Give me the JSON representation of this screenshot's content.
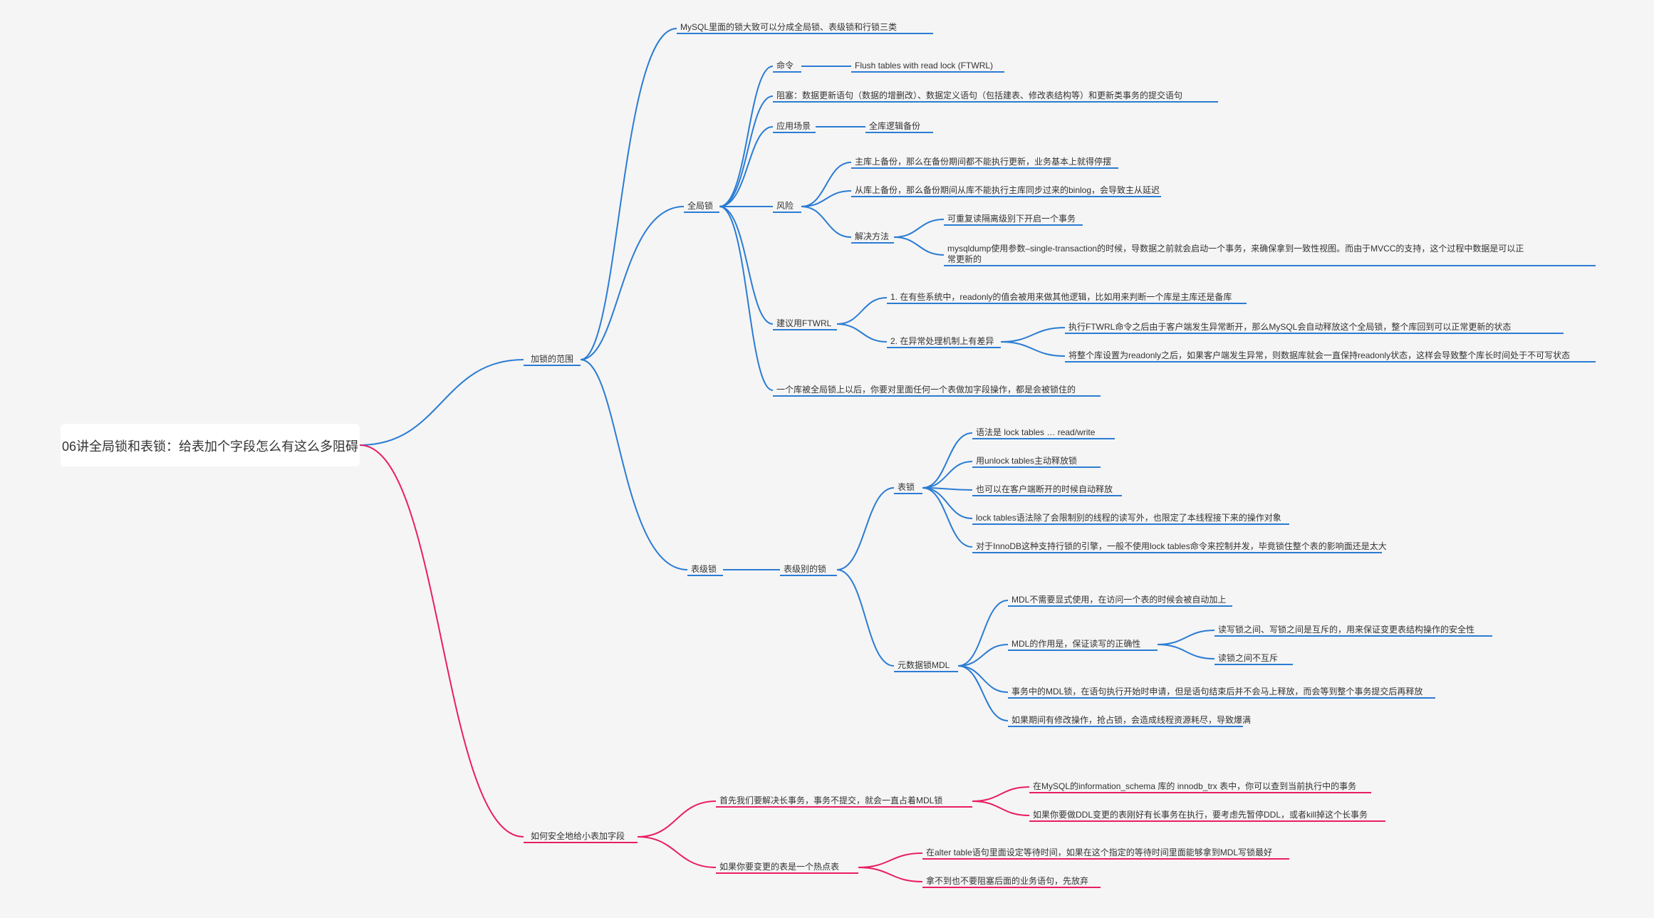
{
  "root": "06讲全局锁和表锁：给表加个字段怎么有这么多阻碍",
  "b1": {
    "title": "加锁的范围",
    "intro": "MySQL里面的锁大致可以分成全局锁、表级锁和行锁三类",
    "global": {
      "title": "全局锁",
      "cmd": {
        "k": "命令",
        "v": "Flush tables with read lock (FTWRL)"
      },
      "block": "阻塞：数据更新语句（数据的增删改）、数据定义语句（包括建表、修改表结构等）和更新类事务的提交语句",
      "usage": {
        "k": "应用场景",
        "v": "全库逻辑备份"
      },
      "risk": {
        "title": "风险",
        "r1": "主库上备份，那么在备份期间都不能执行更新，业务基本上就得停摆",
        "r2": "从库上备份，那么备份期间从库不能执行主库同步过来的binlog，会导致主从延迟",
        "solve": {
          "title": "解决方法",
          "s1": "可重复读隔离级别下开启一个事务",
          "s2": "mysqldump使用参数–single-transaction的时候，导数据之前就会启动一个事务，来确保拿到一致性视图。而由于MVCC的支持，这个过程中数据是可以正常更新的"
        }
      },
      "ftwrl": {
        "title": "建议用FTWRL",
        "r1": "1. 在有些系统中，readonly的值会被用来做其他逻辑，比如用来判断一个库是主库还是备库",
        "r2": {
          "title": "2. 在异常处理机制上有差异",
          "a": "执行FTWRL命令之后由于客户端发生异常断开，那么MySQL会自动释放这个全局锁，整个库回到可以正常更新的状态",
          "b": "将整个库设置为readonly之后，如果客户端发生异常，则数据库就会一直保持readonly状态，这样会导致整个库长时间处于不可写状态"
        }
      },
      "note": "一个库被全局锁上以后，你要对里面任何一个表做加字段操作，都是会被锁住的"
    },
    "table": {
      "title": "表级锁",
      "nest": "表级别的锁",
      "locks": {
        "title": "表锁",
        "l1": "语法是 lock tables … read/write",
        "l2": "用unlock tables主动释放锁",
        "l3": "也可以在客户端断开的时候自动释放",
        "l4": "lock tables语法除了会限制别的线程的读写外，也限定了本线程接下来的操作对象",
        "l5": "对于InnoDB这种支持行锁的引擎，一般不使用lock tables命令来控制并发，毕竟锁住整个表的影响面还是太大"
      },
      "mdl": {
        "title": "元数据锁MDL",
        "m1": "MDL不需要显式使用，在访问一个表的时候会被自动加上",
        "m2": {
          "title": "MDL的作用是，保证读写的正确性",
          "a": "读写锁之间、写锁之间是互斥的，用来保证变更表结构操作的安全性",
          "b": "读锁之间不互斥"
        },
        "m3": "事务中的MDL锁，在语句执行开始时申请，但是语句结束后并不会马上释放，而会等到整个事务提交后再释放",
        "m4": "如果期间有修改操作，抢占锁，会造成线程资源耗尽，导致爆满"
      }
    }
  },
  "b2": {
    "title": "如何安全地给小表加字段",
    "row1": {
      "title": "首先我们要解决长事务，事务不提交，就会一直占着MDL锁",
      "a": "在MySQL的information_schema 库的 innodb_trx 表中，你可以查到当前执行中的事务",
      "b": "如果你要做DDL变更的表刚好有长事务在执行，要考虑先暂停DDL，或者kill掉这个长事务"
    },
    "row2": {
      "title": "如果你要变更的表是一个热点表",
      "a": "在alter table语句里面设定等待时间，如果在这个指定的等待时间里面能够拿到MDL写锁最好",
      "b": "拿不到也不要阻塞后面的业务语句，先放弃"
    }
  }
}
